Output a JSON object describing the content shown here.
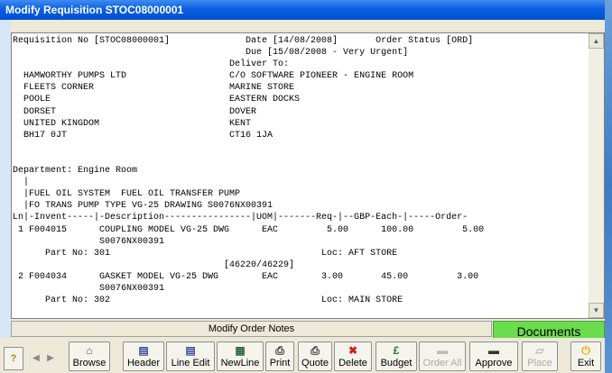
{
  "window": {
    "title": "Modify Requisition STOC08000001"
  },
  "report": {
    "lines": [
      "Requisition No [STOC08000001]              Date [14/08/2008]       Order Status [ORD]",
      "                                           Due [15/08/2008 - Very Urgent]",
      "                                        Deliver To:",
      "  HAMWORTHY PUMPS LTD                   C/O SOFTWARE PIONEER - ENGINE ROOM",
      "  FLEETS CORNER                         MARINE STORE",
      "  POOLE                                 EASTERN DOCKS",
      "  DORSET                                DOVER",
      "  UNITED KINGDOM                        KENT",
      "  BH17 0JT                              CT16 1JA",
      "",
      "",
      "Department: Engine Room",
      "  |",
      "  |FUEL OIL SYSTEM  FUEL OIL TRANSFER PUMP",
      "  |FO TRANS PUMP TYPE VG-25 DRAWING S0076NX00391",
      "Ln|-Invent-----|-Description----------------|UOM|-------Req-|--GBP-Each-|-----Order-",
      " 1 F004015      COUPLING MODEL VG-25 DWG      EAC         5.00      100.00         5.00",
      "                S0076NX00391",
      "      Part No: 301                                       Loc: AFT STORE",
      "                                       [46220/46229]",
      " 2 F004034      GASKET MODEL VG-25 DWG        EAC        3.00       45.00         3.00",
      "                S0076NX00391",
      "      Part No: 302                                       Loc: MAIN STORE"
    ]
  },
  "notes_bar": {
    "label": "Modify Order Notes"
  },
  "documents_button": {
    "label": "Documents",
    "color": "#6bdc4d"
  },
  "toolbar": {
    "help_label": "?",
    "buttons": [
      {
        "label": "Browse",
        "icon": "browse-icon",
        "enabled": true
      },
      {
        "label": "Header",
        "icon": "header-icon",
        "enabled": true
      },
      {
        "label": "Line Edit",
        "icon": "line-edit-icon",
        "enabled": true
      },
      {
        "label": "NewLine",
        "icon": "new-line-icon",
        "enabled": true
      },
      {
        "label": "Print",
        "icon": "print-icon",
        "enabled": true
      },
      {
        "label": "Quote",
        "icon": "quote-icon",
        "enabled": true
      },
      {
        "label": "Delete",
        "icon": "delete-icon",
        "enabled": true
      },
      {
        "label": "Budget",
        "icon": "pound-icon",
        "enabled": true
      },
      {
        "label": "Order All",
        "icon": "order-all-icon",
        "enabled": false
      },
      {
        "label": "Approve",
        "icon": "approve-icon",
        "enabled": true
      },
      {
        "label": "Place",
        "icon": "place-icon",
        "enabled": false
      },
      {
        "label": "Exit",
        "icon": "exit-icon",
        "enabled": true
      }
    ]
  }
}
